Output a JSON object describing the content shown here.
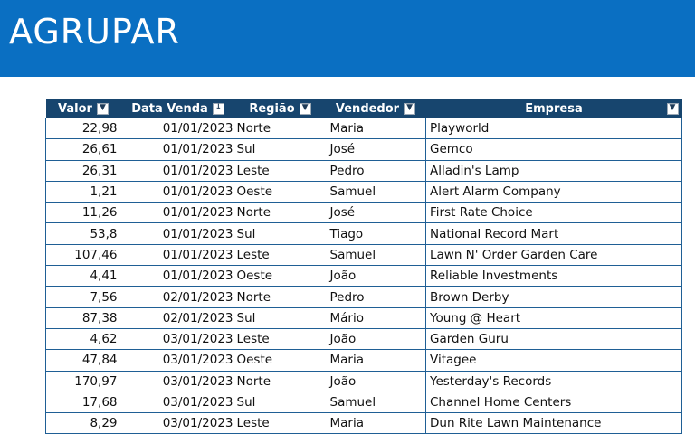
{
  "sheet": {
    "title": "AGRUPAR"
  },
  "colors": {
    "banner": "#0a6fc2",
    "header": "#17456e",
    "grid": "#1f5f95"
  },
  "table": {
    "headers": [
      {
        "label": "Valor",
        "filter_icon": "dropdown-arrow-icon"
      },
      {
        "label": "Data Venda",
        "filter_icon": "sort-ascending-icon"
      },
      {
        "label": "Região",
        "filter_icon": "dropdown-arrow-icon"
      },
      {
        "label": "Vendedor",
        "filter_icon": "dropdown-arrow-icon"
      },
      {
        "label": "Empresa",
        "filter_icon": "dropdown-arrow-icon"
      }
    ],
    "rows": [
      [
        "22,98",
        "01/01/2023",
        "Norte",
        "Maria",
        "Playworld"
      ],
      [
        "26,61",
        "01/01/2023",
        "Sul",
        "José",
        "Gemco"
      ],
      [
        "26,31",
        "01/01/2023",
        "Leste",
        "Pedro",
        "Alladin's Lamp"
      ],
      [
        "1,21",
        "01/01/2023",
        "Oeste",
        "Samuel",
        "Alert Alarm Company"
      ],
      [
        "11,26",
        "01/01/2023",
        "Norte",
        "José",
        "First Rate Choice"
      ],
      [
        "53,8",
        "01/01/2023",
        "Sul",
        "Tiago",
        "National Record Mart"
      ],
      [
        "107,46",
        "01/01/2023",
        "Leste",
        "Samuel",
        "Lawn N' Order Garden Care"
      ],
      [
        "4,41",
        "01/01/2023",
        "Oeste",
        "João",
        "Reliable Investments"
      ],
      [
        "7,56",
        "02/01/2023",
        "Norte",
        "Pedro",
        "Brown Derby"
      ],
      [
        "87,38",
        "02/01/2023",
        "Sul",
        "Mário",
        "Young @ Heart"
      ],
      [
        "4,62",
        "03/01/2023",
        "Leste",
        "João",
        "Garden Guru"
      ],
      [
        "47,84",
        "03/01/2023",
        "Oeste",
        "Maria",
        "Vitagee"
      ],
      [
        "170,97",
        "03/01/2023",
        "Norte",
        "João",
        "Yesterday's Records"
      ],
      [
        "17,68",
        "03/01/2023",
        "Sul",
        "Samuel",
        "Channel Home Centers"
      ],
      [
        "8,29",
        "03/01/2023",
        "Leste",
        "Maria",
        "Dun Rite Lawn Maintenance"
      ]
    ]
  }
}
